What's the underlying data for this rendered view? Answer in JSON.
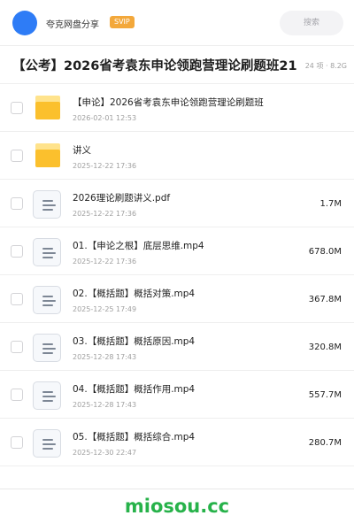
{
  "header": {
    "share_title": "夸克网盘分享",
    "badge": "SVIP",
    "search_placeholder": "搜索"
  },
  "folder": {
    "title": "【公考】2026省考袁东申论领跑营理论刷题班21",
    "meta": "24 项 · 8.2G"
  },
  "files": [
    {
      "type": "folder",
      "name": "【申论】2026省考袁东申论领跑营理论刷题班",
      "date": "2026-02-01 12:53",
      "size": ""
    },
    {
      "type": "folder",
      "name": "讲义",
      "date": "2025-12-22 17:36",
      "size": ""
    },
    {
      "type": "file",
      "name": "2026理论刷题讲义.pdf",
      "date": "2025-12-22 17:36",
      "size": "1.7M"
    },
    {
      "type": "file",
      "name": "01.【申论之根】底层思维.mp4",
      "date": "2025-12-22 17:36",
      "size": "678.0M"
    },
    {
      "type": "file",
      "name": "02.【概括题】概括对策.mp4",
      "date": "2025-12-25 17:49",
      "size": "367.8M"
    },
    {
      "type": "file",
      "name": "03.【概括题】概括原因.mp4",
      "date": "2025-12-28 17:43",
      "size": "320.8M"
    },
    {
      "type": "file",
      "name": "04.【概括题】概括作用.mp4",
      "date": "2025-12-28 17:43",
      "size": "557.7M"
    },
    {
      "type": "file",
      "name": "05.【概括题】概括综合.mp4",
      "date": "2025-12-30 22:47",
      "size": "280.7M"
    }
  ],
  "watermark": "miosou.cc",
  "colors": {
    "accent": "#2e7cf6",
    "svip": "#f3a83b",
    "folder": "#fbc02d",
    "watermark": "#27b24a"
  }
}
